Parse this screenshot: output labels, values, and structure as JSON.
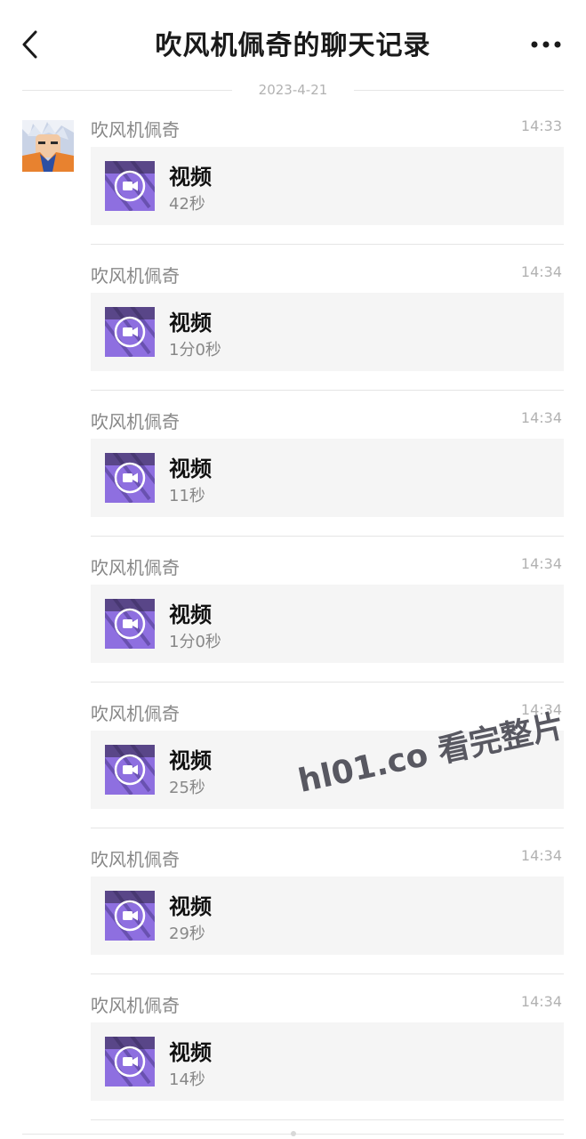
{
  "header": {
    "title": "吹风机佩奇的聊天记录",
    "back_icon": "chevron-left-icon",
    "more_icon": "more-horizontal-icon"
  },
  "date_divider": "2023-4-21",
  "sender_avatar_icon": "anime-avatar",
  "messages": [
    {
      "sender": "吹风机佩奇",
      "time": "14:33",
      "type_label": "视频",
      "duration": "42秒"
    },
    {
      "sender": "吹风机佩奇",
      "time": "14:34",
      "type_label": "视频",
      "duration": "1分0秒"
    },
    {
      "sender": "吹风机佩奇",
      "time": "14:34",
      "type_label": "视频",
      "duration": "11秒"
    },
    {
      "sender": "吹风机佩奇",
      "time": "14:34",
      "type_label": "视频",
      "duration": "1分0秒"
    },
    {
      "sender": "吹风机佩奇",
      "time": "14:34",
      "type_label": "视频",
      "duration": "25秒"
    },
    {
      "sender": "吹风机佩奇",
      "time": "14:34",
      "type_label": "视频",
      "duration": "29秒"
    },
    {
      "sender": "吹风机佩奇",
      "time": "14:34",
      "type_label": "视频",
      "duration": "14秒"
    }
  ],
  "watermark": "hl01.co 看完整片",
  "colors": {
    "thumb_purple": "#8e6fe0",
    "card_bg": "#f5f5f5",
    "muted_text": "#888888"
  }
}
